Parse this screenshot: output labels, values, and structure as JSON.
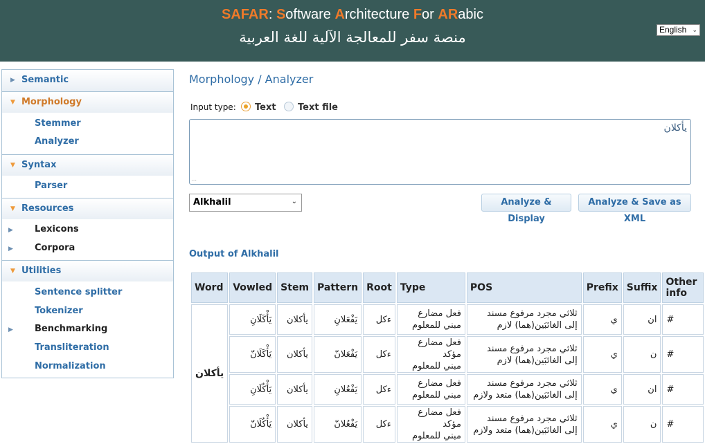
{
  "header": {
    "title_parts": [
      {
        "text": "SAFAR",
        "hl": true
      },
      {
        "text": ": ",
        "hl": false
      },
      {
        "text": "S",
        "hl": true
      },
      {
        "text": "oftware ",
        "hl": false
      },
      {
        "text": "A",
        "hl": true
      },
      {
        "text": "rchitecture ",
        "hl": false
      },
      {
        "text": "F",
        "hl": true
      },
      {
        "text": "or ",
        "hl": false
      },
      {
        "text": "AR",
        "hl": true
      },
      {
        "text": "abic",
        "hl": false
      }
    ],
    "subtitle": "منصة سفر للمعالجة الآلية للغة العربية",
    "language": "English"
  },
  "sidebar": {
    "semantic": "Semantic",
    "morphology": "Morphology",
    "stemmer": "Stemmer",
    "analyzer": "Analyzer",
    "syntax": "Syntax",
    "parser": "Parser",
    "resources": "Resources",
    "lexicons": "Lexicons",
    "corpora": "Corpora",
    "utilities": "Utilities",
    "sentence_splitter": "Sentence splitter",
    "tokenizer": "Tokenizer",
    "benchmarking": "Benchmarking",
    "transliteration": "Transliteration",
    "normalization": "Normalization"
  },
  "main": {
    "title": "Morphology / Analyzer",
    "input_type_label": "Input type:",
    "radio_text": "Text",
    "radio_file": "Text file",
    "input_value": "يأكلان",
    "analyzer_select": "Alkhalil",
    "btn_display": "Analyze & Display",
    "btn_xml": "Analyze & Save as XML",
    "output_title": "Output of Alkhalil"
  },
  "table": {
    "headers": {
      "word": "Word",
      "vowled": "Vowled",
      "stem": "Stem",
      "pattern": "Pattern",
      "root": "Root",
      "type": "Type",
      "pos": "POS",
      "prefix": "Prefix",
      "suffix": "Suffix",
      "other_line1": "Other",
      "other_line2": "info"
    },
    "word": "يأكلان",
    "rows": [
      {
        "vowled": "يَأْكَلَانِ",
        "stem": "يأكلان",
        "pattern": "يَفْعَلانِ",
        "root": "ءكل",
        "type_1": "فعل مضارع",
        "type_2": "مبني للمعلوم",
        "pos_1": "ثلاثي مجرد مرفوع مسند",
        "pos_2": "إلى الغائبَين(هما) لازم",
        "prefix": "ي",
        "suffix": "ان",
        "other": "#"
      },
      {
        "vowled": "يَأْكَلَانّ",
        "stem": "يأكلان",
        "pattern": "يَفْعَلانّ",
        "root": "ءكل",
        "type_1": "فعل مضارع مؤكد",
        "type_2": "مبني للمعلوم",
        "pos_1": "ثلاثي مجرد مرفوع مسند",
        "pos_2": "إلى الغائبَين(هما) لازم",
        "prefix": "ي",
        "suffix": "ن",
        "other": "#"
      },
      {
        "vowled": "يَأْكُلَانِ",
        "stem": "يأكلان",
        "pattern": "يَفْعُلانِ",
        "root": "ءكل",
        "type_1": "فعل مضارع",
        "type_2": "مبني للمعلوم",
        "pos_1": "ثلاثي مجرد مرفوع مسند",
        "pos_2": "إلى الغائبَين(هما) متعد ولازم",
        "prefix": "ي",
        "suffix": "ان",
        "other": "#"
      },
      {
        "vowled": "يَأْكُلَانّ",
        "stem": "يأكلان",
        "pattern": "يَفْعُلانّ",
        "root": "ءكل",
        "type_1": "فعل مضارع مؤكد",
        "type_2": "مبني للمعلوم",
        "pos_1": "ثلاثي مجرد مرفوع مسند",
        "pos_2": "إلى الغائبَين(هما) متعد ولازم",
        "prefix": "ي",
        "suffix": "ن",
        "other": "#"
      }
    ]
  }
}
